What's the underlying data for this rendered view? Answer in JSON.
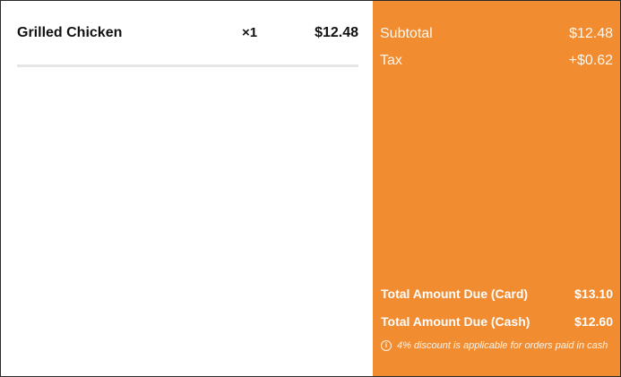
{
  "order": {
    "items": [
      {
        "name": "Grilled Chicken",
        "quantity": "×1",
        "price": "$12.48"
      }
    ]
  },
  "summary": {
    "subtotal_label": "Subtotal",
    "subtotal_value": "$12.48",
    "tax_label": "Tax",
    "tax_value": "+$0.62",
    "card_label": "Total Amount Due (Card)",
    "card_value": "$13.10",
    "cash_label": "Total Amount Due (Cash)",
    "cash_value": "$12.60",
    "discount_note": "4% discount is applicable for orders paid in cash"
  },
  "colors": {
    "accent": "#f28c31"
  },
  "icons": {
    "note_icon": "info-icon"
  }
}
